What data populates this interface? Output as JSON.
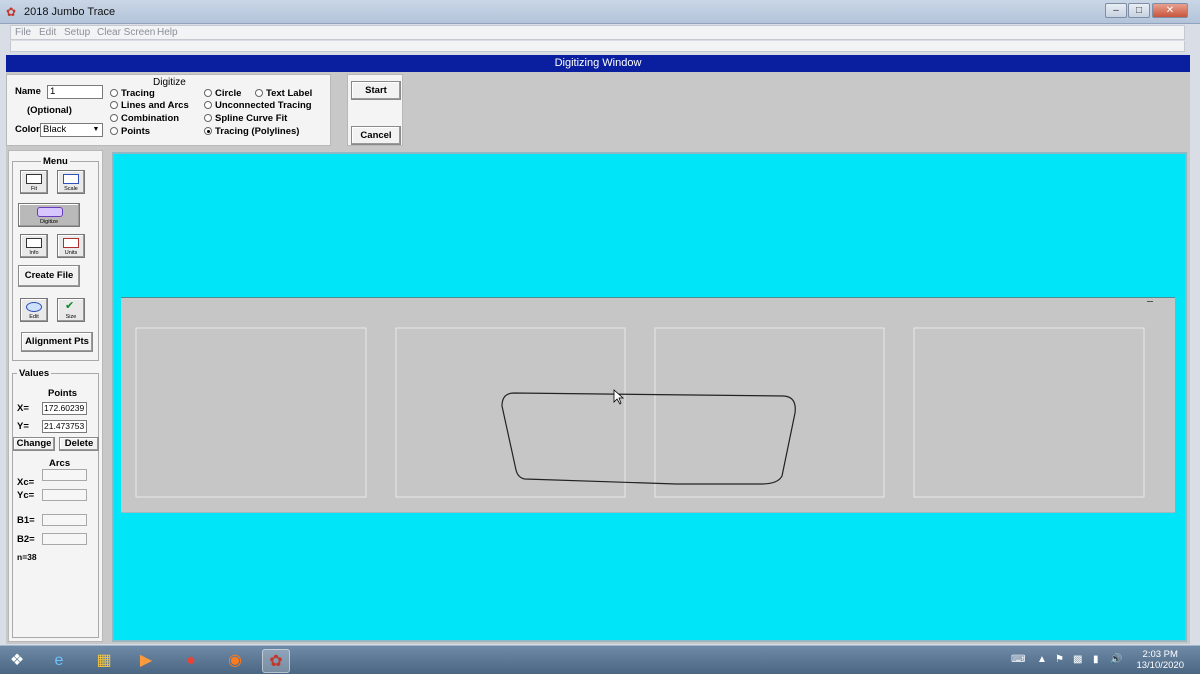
{
  "window": {
    "title": "2018 Jumbo Trace",
    "minimize": "–",
    "maximize": "□",
    "close": "✕"
  },
  "menu": [
    "File",
    "Edit",
    "Setup",
    "Clear Screen",
    "Help"
  ],
  "digitizing_window_title": "Digitizing Window",
  "digitize_panel": {
    "title": "Digitize",
    "name_label": "Name",
    "name_value": "1",
    "optional_label": "(Optional)",
    "color_label": "Color",
    "color_value": "Black",
    "options": [
      {
        "label": "Tracing",
        "selected": false
      },
      {
        "label": "Lines and Arcs",
        "selected": false
      },
      {
        "label": "Combination",
        "selected": false
      },
      {
        "label": "Points",
        "selected": false
      },
      {
        "label": "Circle",
        "selected": false
      },
      {
        "label": "Text Label",
        "selected": false
      },
      {
        "label": "Unconnected Tracing",
        "selected": false
      },
      {
        "label": "Spline Curve Fit",
        "selected": false
      },
      {
        "label": "Tracing (Polylines)",
        "selected": true
      }
    ],
    "start_label": "Start",
    "cancel_label": "Cancel"
  },
  "side_menu": {
    "title": "Menu",
    "tools": {
      "fit": "Fit",
      "scale": "Scale",
      "digitize": "Digitize",
      "info": "Info",
      "units": "Units",
      "edit": "Edit",
      "size": "Size"
    },
    "create_file": "Create File",
    "alignment_pts": "Alignment Pts"
  },
  "values_panel": {
    "title": "Values",
    "points_title": "Points",
    "x_label": "X=",
    "x_value": "172.60239",
    "y_label": "Y=",
    "y_value": "21.473753",
    "change_label": "Change",
    "delete_label": "Delete",
    "arcs_title": "Arcs",
    "xc_label": "Xc=",
    "yc_label": "Yc=",
    "b1_label": "B1=",
    "b2_label": "B2=",
    "count_label": "n=38"
  },
  "taskbar": {
    "time": "2:03 PM",
    "date": "13/10/2020"
  },
  "colors": {
    "header_blue": "#0a1fa0",
    "canvas_cyan": "#00e5f8",
    "drawing_gray": "#c6c6c6"
  }
}
